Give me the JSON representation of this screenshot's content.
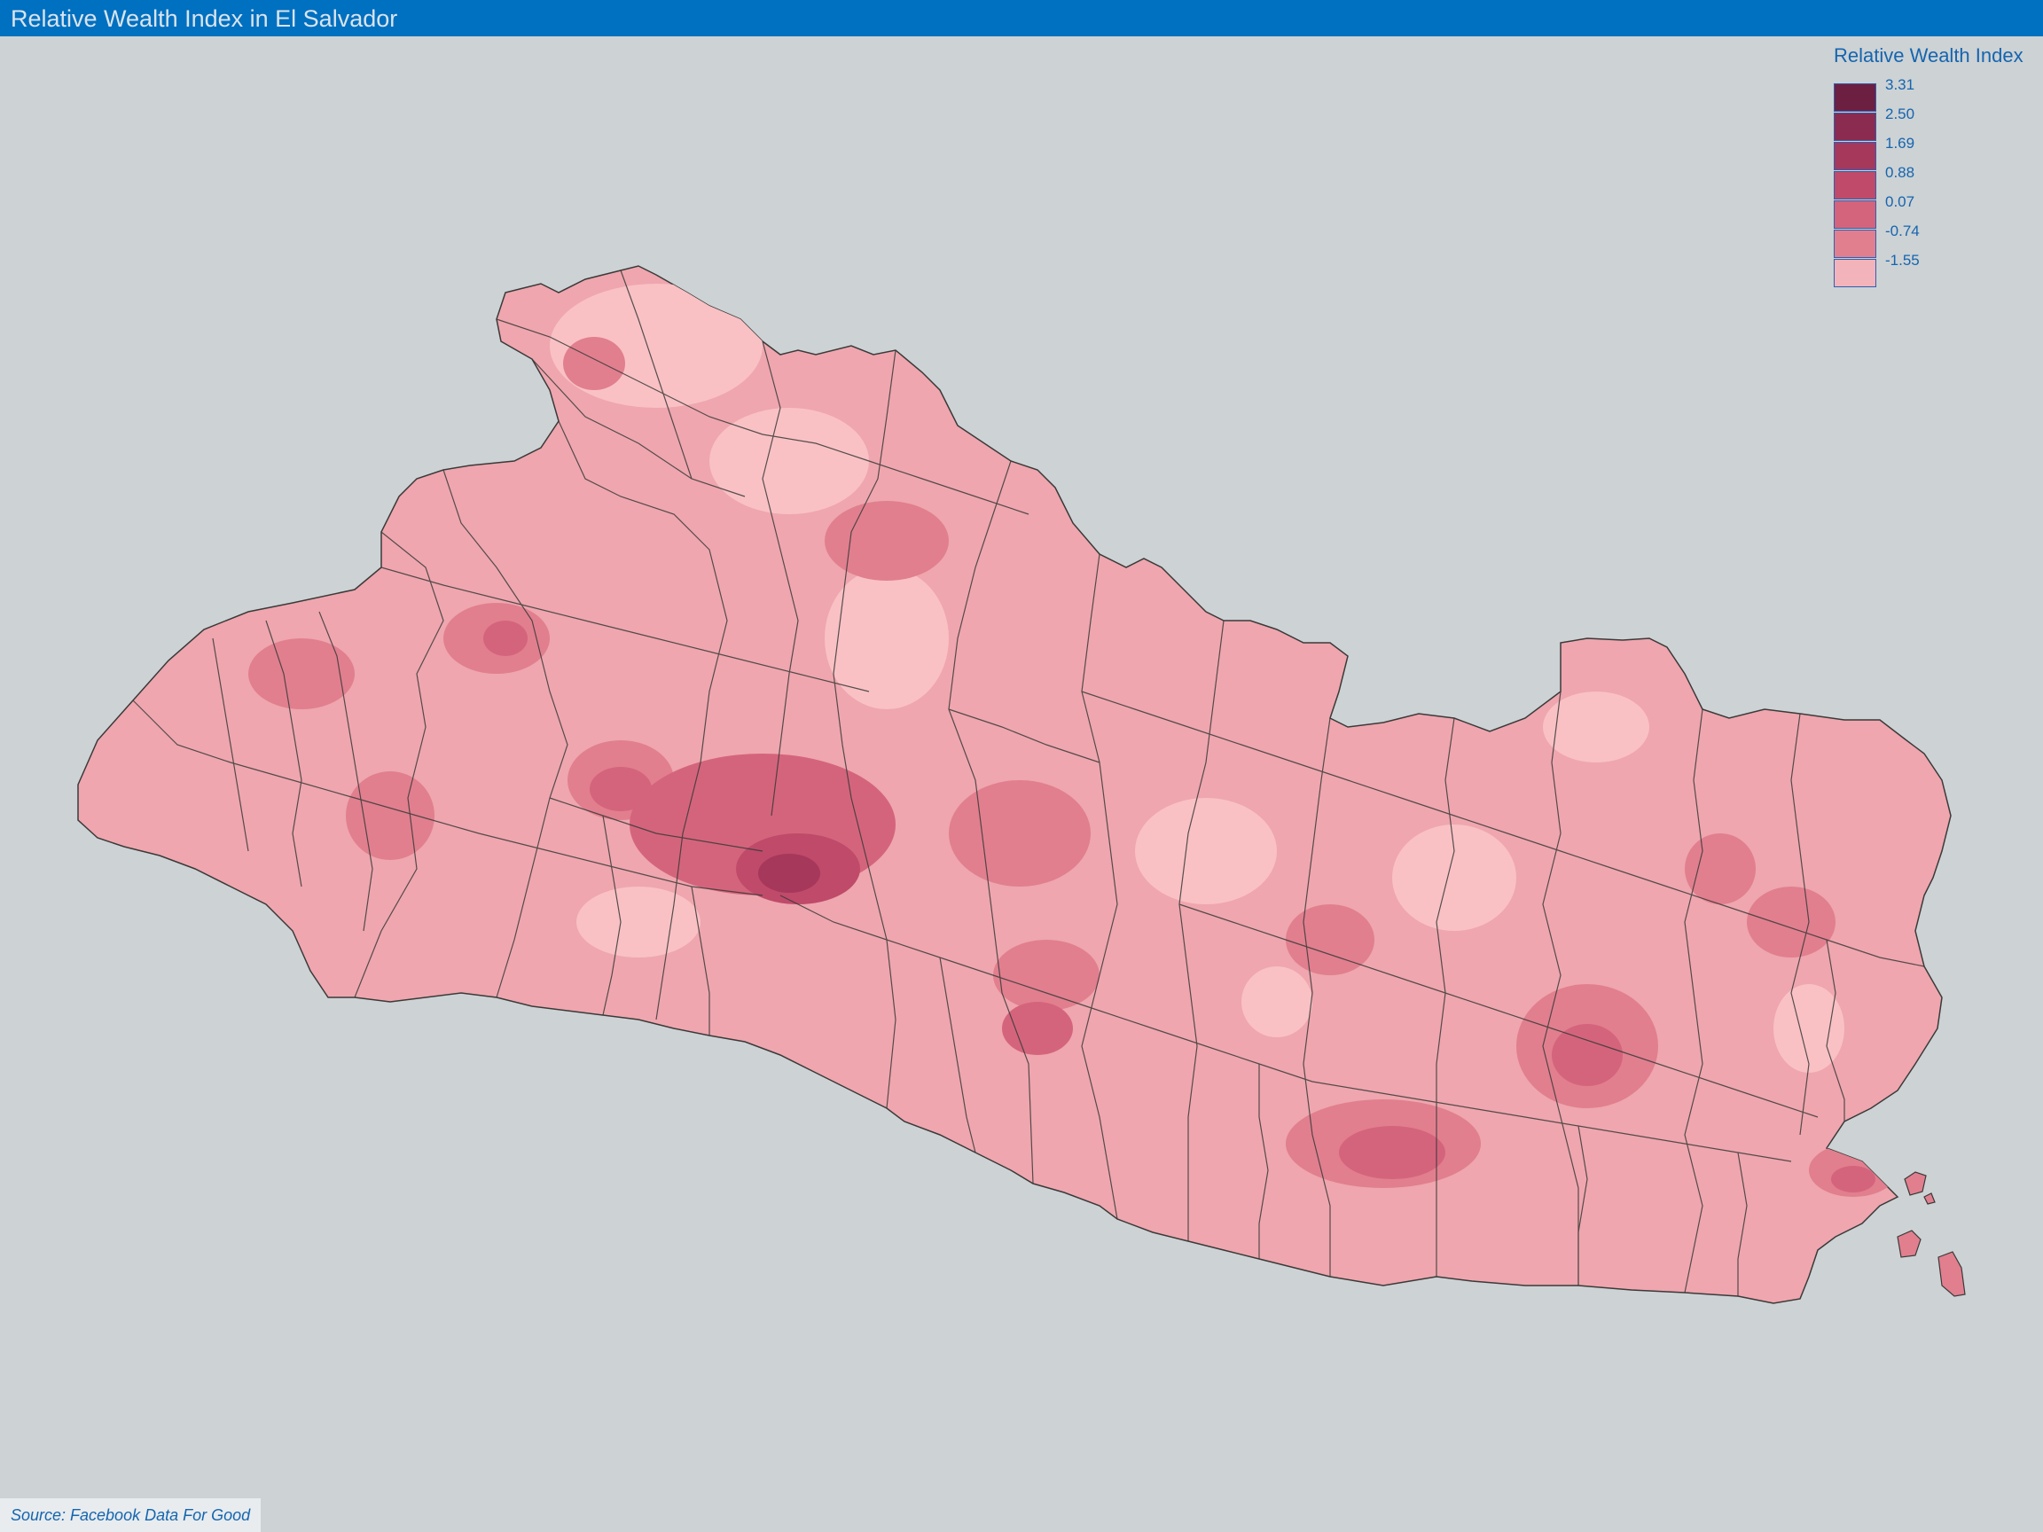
{
  "header": {
    "title": "Relative Wealth Index in El Salvador"
  },
  "legend": {
    "title": "Relative Wealth Index",
    "items": [
      {
        "label": "3.31",
        "color": "#6d1f42"
      },
      {
        "label": "2.50",
        "color": "#8a2b4f"
      },
      {
        "label": "1.69",
        "color": "#a6385c"
      },
      {
        "label": "0.88",
        "color": "#bf4a6a"
      },
      {
        "label": "0.07",
        "color": "#d4647c"
      },
      {
        "label": "-0.74",
        "color": "#e17f8e"
      },
      {
        "label": "-1.55",
        "color": "#f3b3ba"
      }
    ]
  },
  "map": {
    "base_fill": "#efa6ae",
    "light_fill": "#f9c1c4",
    "dark_fill": "#c04e6b",
    "border_color": "#3a3a3a",
    "ocean_color": "#cdd2d4"
  },
  "footer": {
    "source": "Source: Facebook Data For Good"
  }
}
